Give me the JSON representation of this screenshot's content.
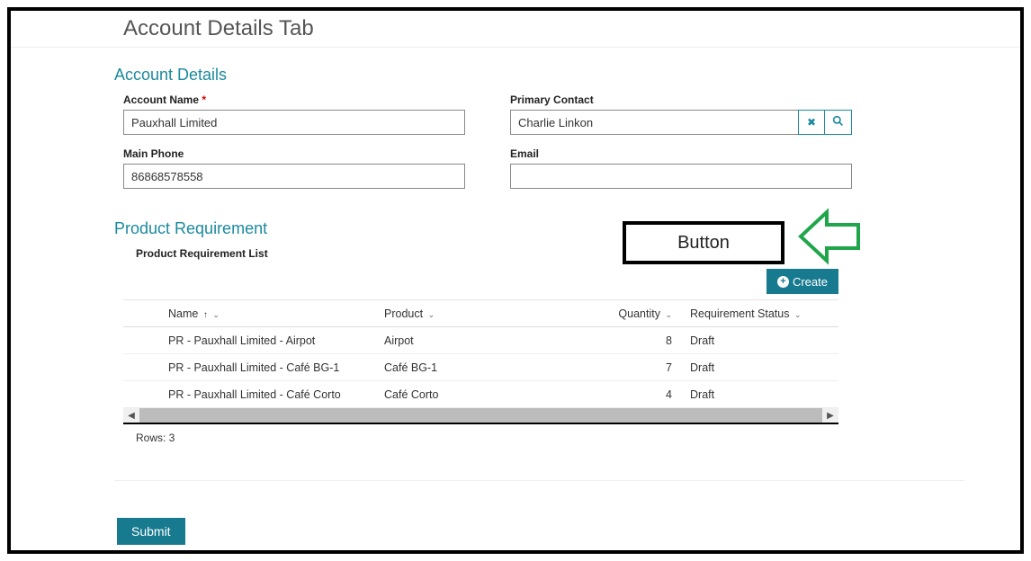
{
  "page": {
    "title": "Account Details Tab"
  },
  "accountDetails": {
    "header": "Account Details",
    "accountName": {
      "label": "Account Name",
      "required": "*",
      "value": "Pauxhall Limited"
    },
    "primaryContact": {
      "label": "Primary Contact",
      "value": "Charlie Linkon"
    },
    "mainPhone": {
      "label": "Main Phone",
      "value": "86868578558"
    },
    "email": {
      "label": "Email",
      "value": ""
    }
  },
  "annotation": {
    "buttonLabel": "Button"
  },
  "productRequirement": {
    "header": "Product Requirement",
    "listTitle": "Product Requirement List",
    "createLabel": "Create",
    "columns": {
      "name": "Name",
      "product": "Product",
      "quantity": "Quantity",
      "status": "Requirement Status"
    },
    "rows": [
      {
        "name": "PR - Pauxhall Limited - Airpot",
        "product": "Airpot",
        "quantity": "8",
        "status": "Draft"
      },
      {
        "name": "PR - Pauxhall Limited - Café BG-1",
        "product": "Café BG-1",
        "quantity": "7",
        "status": "Draft"
      },
      {
        "name": "PR - Pauxhall Limited - Café Corto",
        "product": "Café Corto",
        "quantity": "4",
        "status": "Draft"
      }
    ],
    "rowsLabel": "Rows: 3"
  },
  "actions": {
    "submit": "Submit"
  }
}
